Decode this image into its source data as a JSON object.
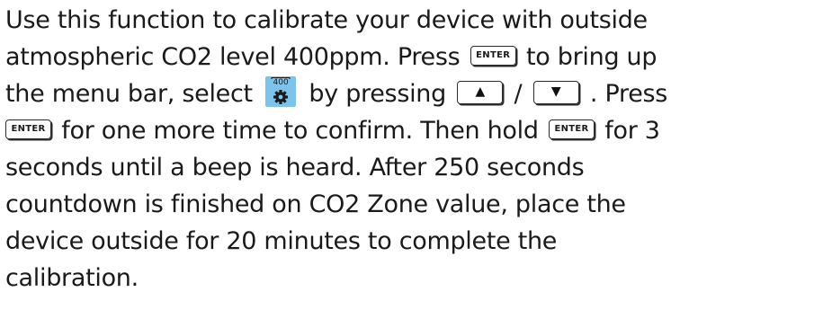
{
  "paragraph": {
    "l1": "Use this function to calibrate your device with outside",
    "l2a": "atmospheric CO2 level 400ppm. Press",
    "l2b": "to bring up",
    "l3a": "the menu bar, select",
    "l3b": "by pressing",
    "l3c": "/",
    "l3d": ". Press",
    "l4a": "for one more time to confirm. Then hold",
    "l4b": "for 3",
    "l5": "seconds until a beep is heard. After 250 seconds",
    "l6": "countdown is finished on CO2 Zone value, place the",
    "l7": "device outside for 20 minutes to complete the",
    "l8": "calibration."
  },
  "keys": {
    "enter_label": "ENTER",
    "up_arrow": "▲",
    "down_arrow": "▼"
  },
  "icons": {
    "calibration_menu_icon": {
      "name": "co2-400-calibration-gear-icon",
      "label": "400",
      "background": "#7cc4ec"
    }
  }
}
